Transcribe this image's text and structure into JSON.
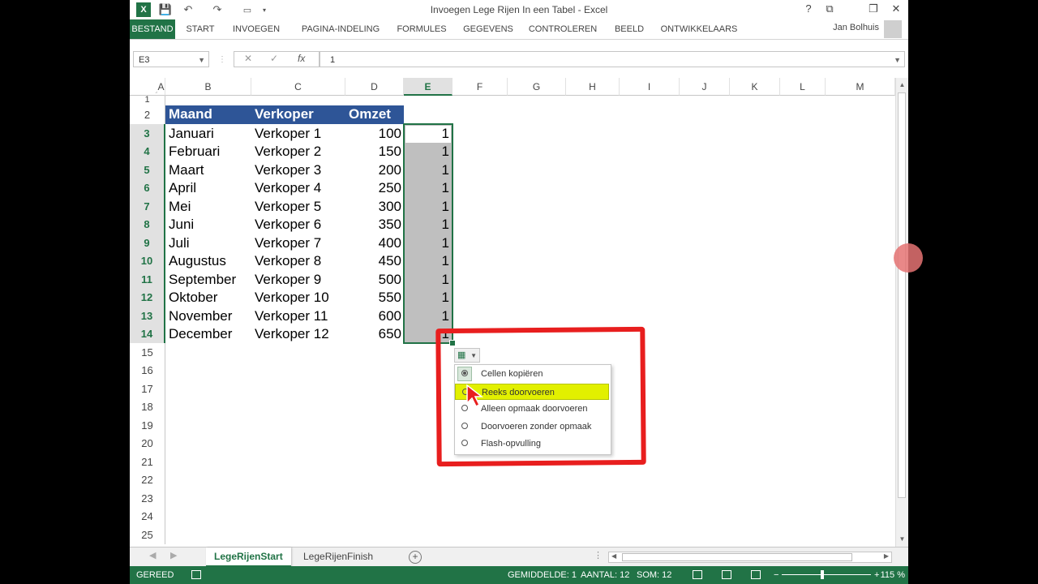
{
  "window": {
    "title": "Invoegen Lege Rijen In een Tabel - Excel",
    "user": "Jan Bolhuis"
  },
  "quick_access": {
    "logo": "X",
    "save_icon": "💾",
    "undo_icon": "↶",
    "redo_icon": "↷"
  },
  "window_controls": {
    "help": "?",
    "ribbon_options": "⧉",
    "restore": "❐",
    "close": "✕"
  },
  "ribbon_tabs": [
    "BESTAND",
    "START",
    "INVOEGEN",
    "PAGINA-INDELING",
    "FORMULES",
    "GEGEVENS",
    "CONTROLEREN",
    "BEELD",
    "ONTWIKKELAARS"
  ],
  "formula_bar": {
    "name_box": "E3",
    "cancel_icon": "✕",
    "enter_icon": "✓",
    "fx": "fx",
    "value": "1"
  },
  "columns": [
    "A",
    "B",
    "C",
    "D",
    "E",
    "F",
    "G",
    "H",
    "I",
    "J",
    "K",
    "L",
    "M"
  ],
  "selected_column": "E",
  "rows": [
    "1",
    "2",
    "3",
    "4",
    "5",
    "6",
    "7",
    "8",
    "9",
    "10",
    "11",
    "12",
    "13",
    "14",
    "15",
    "16",
    "17",
    "18",
    "19",
    "20",
    "21",
    "22",
    "23",
    "24",
    "25"
  ],
  "table": {
    "headers": [
      "Maand",
      "Verkoper",
      "Omzet"
    ],
    "data": [
      {
        "maand": "Januari",
        "verkoper": "Verkoper 1",
        "omzet": "100",
        "e": "1"
      },
      {
        "maand": "Februari",
        "verkoper": "Verkoper 2",
        "omzet": "150",
        "e": "1"
      },
      {
        "maand": "Maart",
        "verkoper": "Verkoper 3",
        "omzet": "200",
        "e": "1"
      },
      {
        "maand": "April",
        "verkoper": "Verkoper 4",
        "omzet": "250",
        "e": "1"
      },
      {
        "maand": "Mei",
        "verkoper": "Verkoper 5",
        "omzet": "300",
        "e": "1"
      },
      {
        "maand": "Juni",
        "verkoper": "Verkoper 6",
        "omzet": "350",
        "e": "1"
      },
      {
        "maand": "Juli",
        "verkoper": "Verkoper 7",
        "omzet": "400",
        "e": "1"
      },
      {
        "maand": "Augustus",
        "verkoper": "Verkoper 8",
        "omzet": "450",
        "e": "1"
      },
      {
        "maand": "September",
        "verkoper": "Verkoper 9",
        "omzet": "500",
        "e": "1"
      },
      {
        "maand": "Oktober",
        "verkoper": "Verkoper 10",
        "omzet": "550",
        "e": "1"
      },
      {
        "maand": "November",
        "verkoper": "Verkoper 11",
        "omzet": "600",
        "e": "1"
      },
      {
        "maand": "December",
        "verkoper": "Verkoper 12",
        "omzet": "650",
        "e": "1"
      }
    ]
  },
  "autofill_menu": {
    "items": [
      "Cellen kopiëren",
      "Reeks doorvoeren",
      "Alleen opmaak doorvoeren",
      "Doorvoeren zonder opmaak",
      "Flash-opvulling"
    ],
    "selected_index": 0,
    "highlighted_index": 1
  },
  "sheets": [
    "LegeRijenStart",
    "LegeRijenFinish"
  ],
  "active_sheet": 0,
  "status": {
    "mode": "GEREED",
    "gemiddelde": "GEMIDDELDE: 1",
    "aantal": "AANTAL: 12",
    "som": "SOM: 12",
    "zoom": "115 %",
    "zoom_minus": "−",
    "zoom_plus": "+"
  },
  "colors": {
    "excel_green": "#217346",
    "table_header": "#2e5597",
    "highlight": "#e2f000",
    "annotation_red": "#e81e1e"
  }
}
